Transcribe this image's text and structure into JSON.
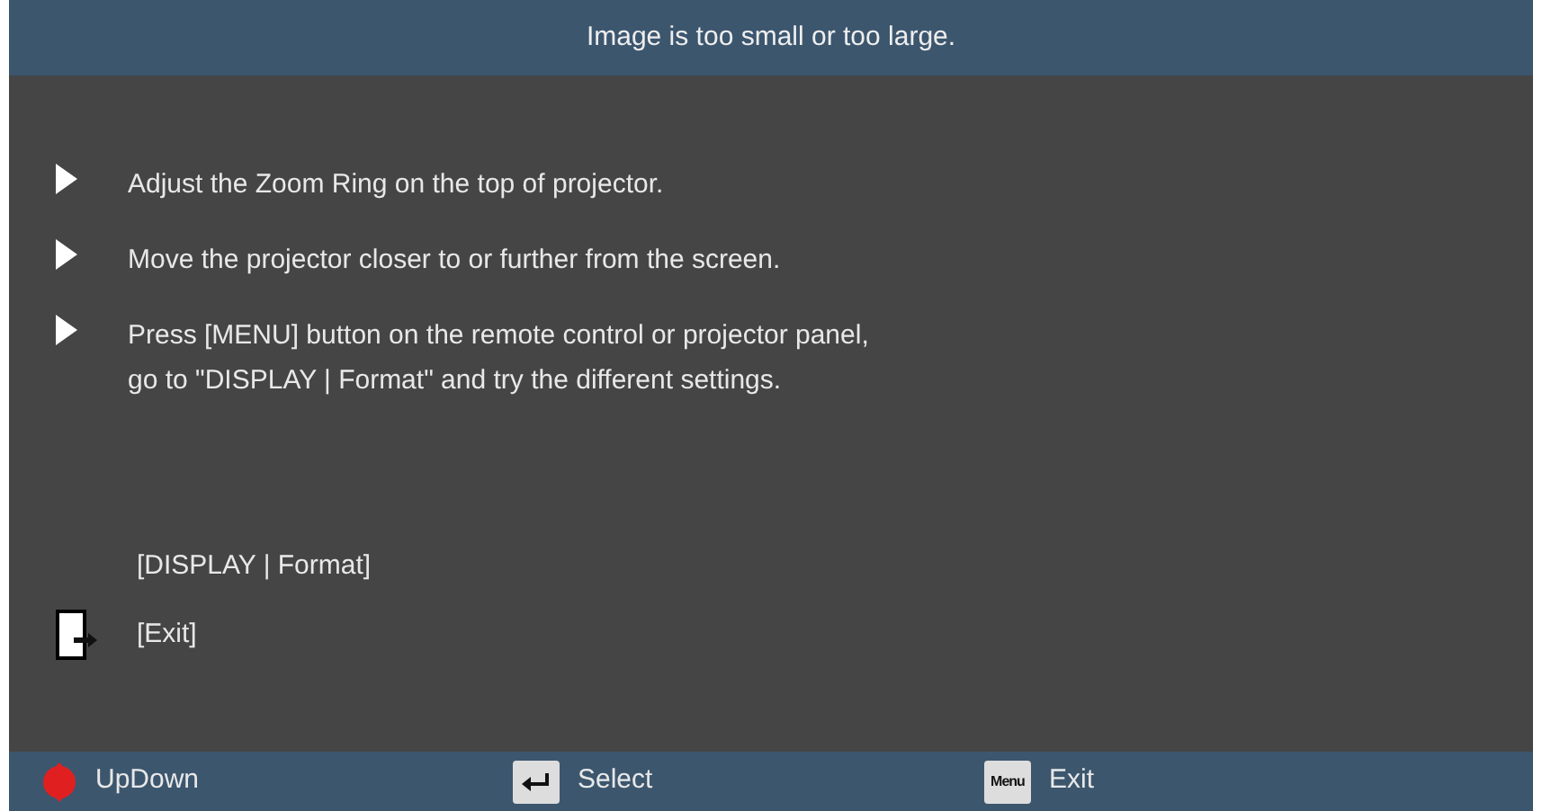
{
  "window": {
    "title": "Image is too small or too large."
  },
  "tips": [
    {
      "lines": [
        "Adjust the Zoom Ring on the top of projector."
      ]
    },
    {
      "lines": [
        "Move the projector closer to or further from the screen."
      ]
    },
    {
      "lines": [
        "Press [MENU] button on the remote control or projector panel,",
        "go to \"DISPLAY | Format\" and try the different settings."
      ]
    }
  ],
  "menu_items": [
    {
      "kind": "link",
      "label": "[DISPLAY | Format]"
    },
    {
      "kind": "exit",
      "label": "[Exit]"
    }
  ],
  "footer": [
    {
      "kind": "updown",
      "label": "UpDown"
    },
    {
      "kind": "enter",
      "label": "Select"
    },
    {
      "kind": "menu",
      "key": "Menu",
      "label": "Exit"
    }
  ]
}
